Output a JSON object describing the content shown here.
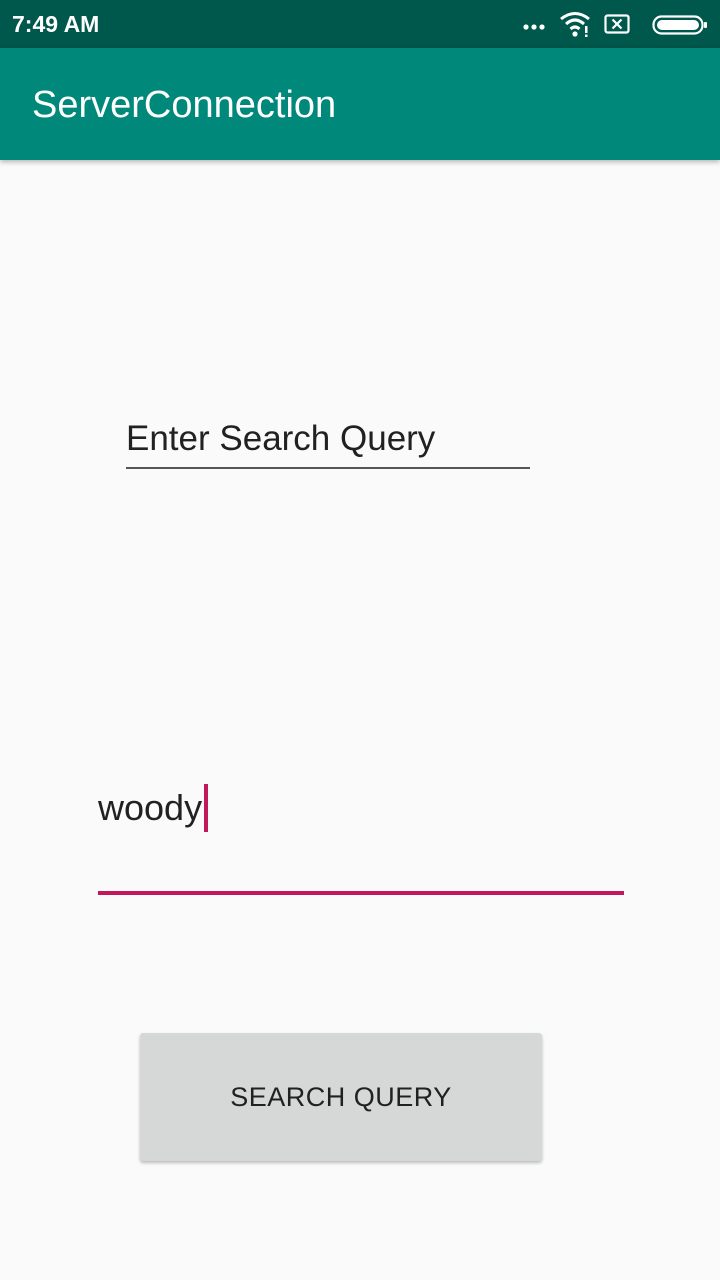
{
  "status_bar": {
    "time": "7:49 AM",
    "icons": [
      "more-dots-icon",
      "wifi-icon",
      "no-sim-icon",
      "battery-icon"
    ]
  },
  "app_bar": {
    "title": "ServerConnection",
    "color": "#00897b"
  },
  "hint_field": {
    "text": "Enter Search Query"
  },
  "query_input": {
    "value": "woody",
    "accent": "#c2185b"
  },
  "search_button": {
    "label": "SEARCH QUERY"
  }
}
